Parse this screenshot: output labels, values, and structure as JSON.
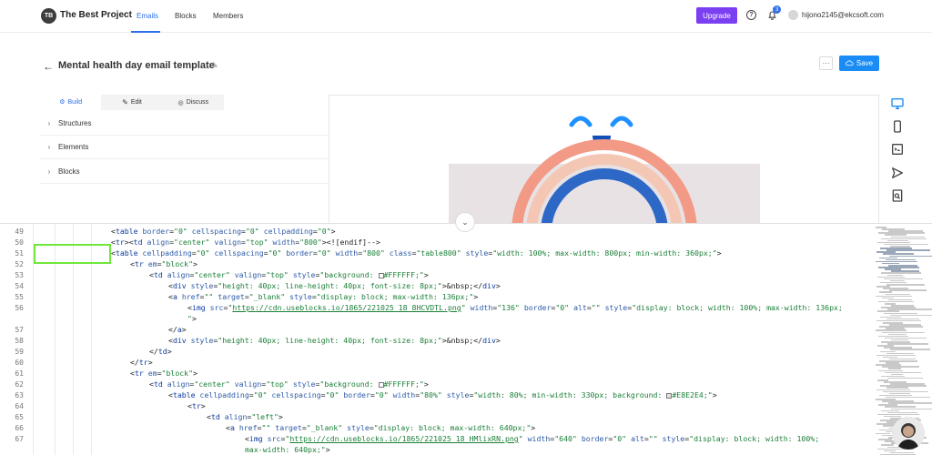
{
  "app": {
    "logo_initials": "TB",
    "title": "The Best Project"
  },
  "nav": {
    "tabs": [
      {
        "label": "Emails"
      },
      {
        "label": "Blocks"
      },
      {
        "label": "Members"
      }
    ]
  },
  "topbar": {
    "upgrade_label": "Upgrade",
    "help_glyph": "?",
    "notifications_count": "3",
    "user_email": "hijono2145@ekcsoft.com"
  },
  "header": {
    "back_glyph": "←",
    "title": "Mental health day email template",
    "more_glyph": "···",
    "save_label": "Save"
  },
  "left_panel": {
    "tabs": [
      {
        "label": "Build"
      },
      {
        "label": "Edit"
      },
      {
        "label": "Discuss"
      }
    ],
    "sections": [
      {
        "label": "Structures"
      },
      {
        "label": "Elements"
      },
      {
        "label": "Blocks"
      }
    ]
  },
  "editor": {
    "line_numbers": [
      "49",
      "50",
      "51",
      "52",
      "53",
      "54",
      "55",
      "56",
      "",
      "57",
      "58",
      "59",
      "60",
      "61",
      "62",
      "63",
      "64",
      "65",
      "66",
      "67",
      "",
      ""
    ]
  },
  "colors": {
    "accent": "#2f6fea",
    "upgrade": "#7b3ff2",
    "save": "#1a8cf5",
    "highlight": "#6fe63a"
  }
}
